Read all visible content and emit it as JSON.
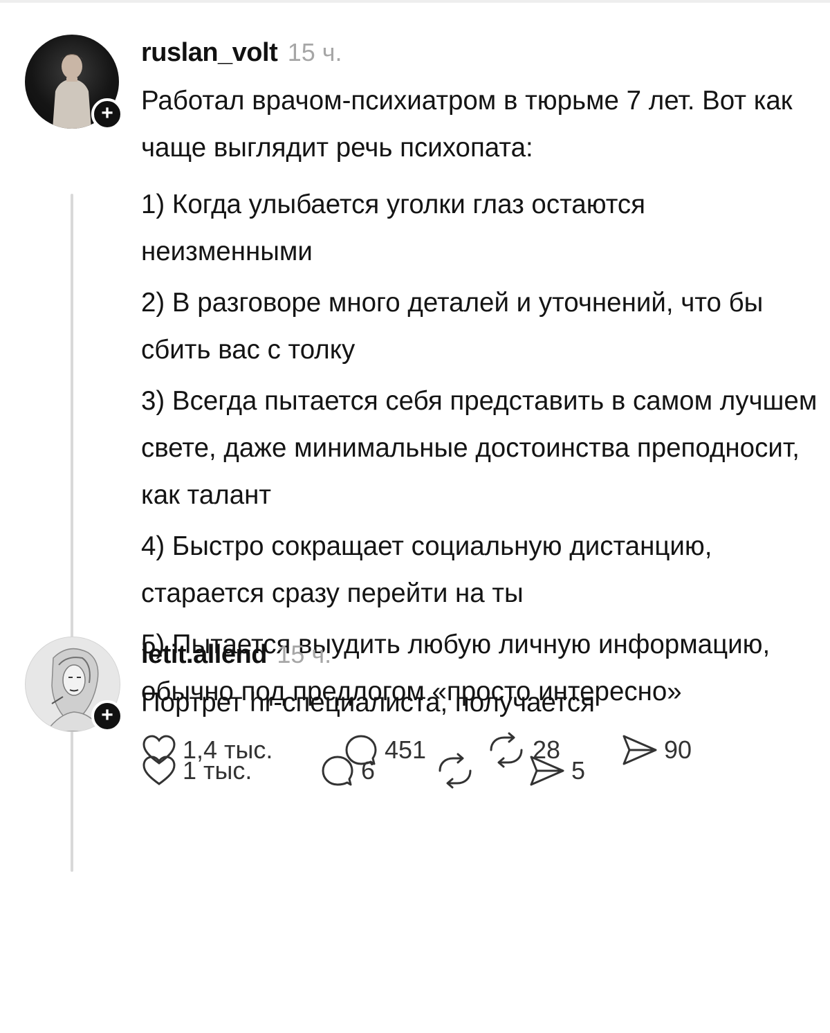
{
  "posts": [
    {
      "username": "ruslan_volt",
      "time": "15 ч.",
      "intro": "Работал врачом-психиатром в тюрьме 7 лет. Вот как чаще выглядит речь психопата:",
      "items": [
        "1) Когда улыбается уголки глаз остаются неизменными",
        "2) В разговоре много деталей и уточнений, что бы сбить вас с толку",
        "3) Всегда пытается себя представить в самом лучшем свете, даже минимальные достоинства преподносит, как талант",
        "4) Быстро сокращает социальную дистанцию, старается сразу перейти на ты",
        "5) Пытается выудить любую личную информацию, обычно под предлогом «просто интересно»"
      ],
      "likes": "1,4 тыс.",
      "comments": "451",
      "reposts": "28",
      "shares": "90",
      "follow_label": "+"
    },
    {
      "username": "letit.allend",
      "time": "15 ч.",
      "intro": "Портрет hr-специалиста, получается",
      "likes": "1 тыс.",
      "comments": "6",
      "reposts": "",
      "shares": "5",
      "follow_label": "+"
    }
  ],
  "icons": {
    "like": "heart-icon",
    "comment": "speech-bubble-icon",
    "repost": "repost-arrows-icon",
    "share": "send-icon",
    "follow": "plus-icon"
  },
  "colors": {
    "text": "#141414",
    "muted": "#a6a6a6",
    "thread_line": "#d9d9d9"
  }
}
